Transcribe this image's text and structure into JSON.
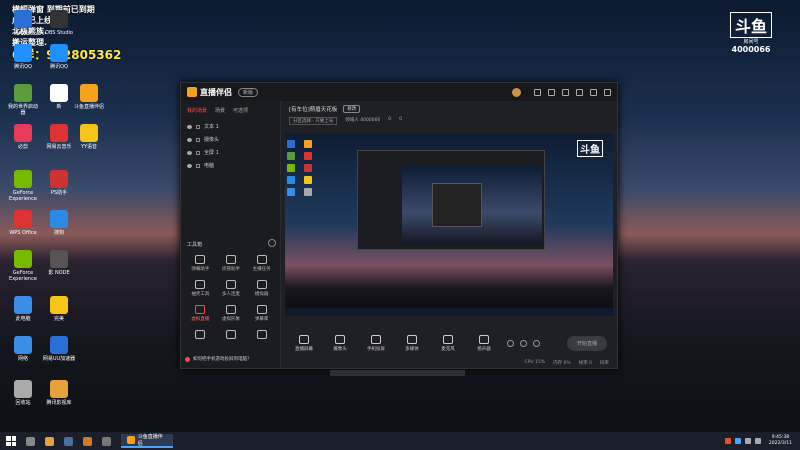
{
  "overlay": {
    "line1": "横幅弹窗 到期前已到期",
    "line2": "成品已上线",
    "line3": "北极熊族.",
    "line4": "搬运整理.",
    "qq": "Q群：932805362"
  },
  "douyu_logo": {
    "mark": "斗鱼",
    "sub": "房间号",
    "room": "4000066"
  },
  "desktop_icons": [
    {
      "label": "Adobe",
      "color": "#2a6fd6"
    },
    {
      "label": "OBS Studio",
      "color": "#333"
    },
    {
      "label": "腾讯QQ",
      "color": "#1e90ff"
    },
    {
      "label": "腾讯QQ",
      "color": "#1e90ff"
    },
    {
      "label": "我的世界启动器",
      "color": "#5a9b3a"
    },
    {
      "label": "新",
      "color": "#fff"
    },
    {
      "label": "斗鱼直播伴侣",
      "color": "#f7a21b"
    },
    {
      "label": "必剪",
      "color": "#e83a5a"
    },
    {
      "label": "网易云音乐",
      "color": "#d33"
    },
    {
      "label": "YY语音",
      "color": "#f5c518"
    },
    {
      "label": "GeForce Experience",
      "color": "#76b900"
    },
    {
      "label": "PS助手",
      "color": "#c33"
    },
    {
      "label": "WPS Office",
      "color": "#d33"
    },
    {
      "label": "搜狗",
      "color": "#2a8ae6"
    },
    {
      "label": "GeForce Experience",
      "color": "#76b900"
    },
    {
      "label": "影 NODE",
      "color": "#555"
    },
    {
      "label": "此电脑",
      "color": "#3a8ee6"
    },
    {
      "label": "完美",
      "color": "#f5c518"
    },
    {
      "label": "网络",
      "color": "#3a8ee6"
    },
    {
      "label": "网易UU加速器",
      "color": "#2a6fd6"
    },
    {
      "label": "回收站",
      "color": "#aaa"
    },
    {
      "label": "腾讯影视库",
      "color": "#e8a13a"
    }
  ],
  "app": {
    "name": "直播伴侣",
    "version": "新版",
    "tabs": [
      "我的场景",
      "场景",
      "可选项"
    ],
    "sources": [
      "文本 1",
      "摄像头",
      "全屏 1",
      "电脑"
    ],
    "tools_title": "工具箱",
    "tools": [
      {
        "label": "弹幕助手",
        "red": false
      },
      {
        "label": "房管助手",
        "red": false
      },
      {
        "label": "主播任务",
        "red": false
      },
      {
        "label": "抽奖工具",
        "red": false
      },
      {
        "label": "多人连麦",
        "red": false
      },
      {
        "label": "模拟器",
        "red": false
      },
      {
        "label": "虚拟直播",
        "red": true
      },
      {
        "label": "虚拟形象",
        "red": false
      },
      {
        "label": "弹幕库",
        "red": false
      },
      {
        "label": "",
        "red": false
      },
      {
        "label": "",
        "red": false
      },
      {
        "label": "",
        "red": false
      }
    ],
    "tip": "如何把手机游戏投屏到电脑？",
    "room_title": "[有车位]萌眉天花板",
    "room_edit": "修改",
    "room_sub": [
      "分区选择 · 只要上号",
      "领域人 4000066",
      "0",
      "0"
    ],
    "controls": [
      "直播屏幕",
      "摄像头",
      "手机投屏",
      "多媒体",
      "麦克风",
      "扬声器"
    ],
    "start_label": "开始直播",
    "status": [
      "CPU 15%",
      "内存 0%",
      "帧率 0",
      "码率"
    ]
  },
  "taskbar": {
    "app_label": "斗鱼直播伴侣",
    "time": "9:45:38",
    "date": "2022/3/11"
  }
}
